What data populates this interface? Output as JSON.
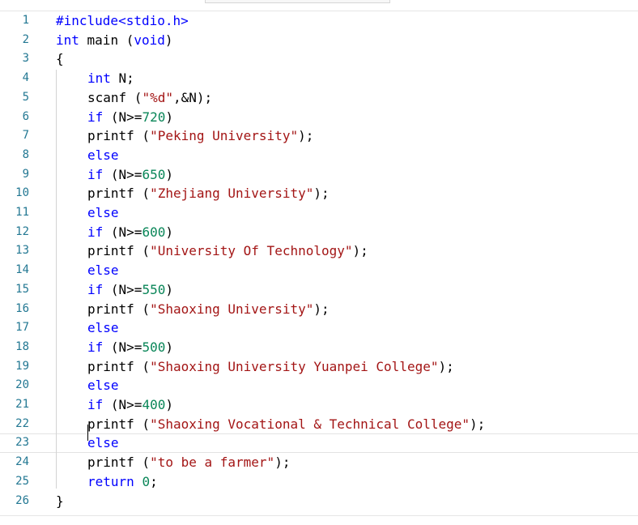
{
  "editor": {
    "lines": [
      {
        "num": "1",
        "indent": 0,
        "tokens": [
          {
            "t": "#include<stdio.h>",
            "c": "kw"
          }
        ]
      },
      {
        "num": "2",
        "indent": 0,
        "tokens": [
          {
            "t": "int",
            "c": "kw"
          },
          {
            "t": " main (",
            "c": "plain"
          },
          {
            "t": "void",
            "c": "kw"
          },
          {
            "t": ")",
            "c": "plain"
          }
        ]
      },
      {
        "num": "3",
        "indent": 0,
        "tokens": [
          {
            "t": "{",
            "c": "plain"
          }
        ]
      },
      {
        "num": "4",
        "indent": 1,
        "tokens": [
          {
            "t": "int",
            "c": "kw"
          },
          {
            "t": " N;",
            "c": "plain"
          }
        ]
      },
      {
        "num": "5",
        "indent": 1,
        "tokens": [
          {
            "t": "scanf (",
            "c": "plain"
          },
          {
            "t": "\"%d\"",
            "c": "str"
          },
          {
            "t": ",&N);",
            "c": "plain"
          }
        ]
      },
      {
        "num": "6",
        "indent": 1,
        "tokens": [
          {
            "t": "if",
            "c": "kw"
          },
          {
            "t": " (N>=",
            "c": "plain"
          },
          {
            "t": "720",
            "c": "num"
          },
          {
            "t": ")",
            "c": "plain"
          }
        ]
      },
      {
        "num": "7",
        "indent": 1,
        "tokens": [
          {
            "t": "printf (",
            "c": "plain"
          },
          {
            "t": "\"Peking University\"",
            "c": "str"
          },
          {
            "t": ");",
            "c": "plain"
          }
        ]
      },
      {
        "num": "8",
        "indent": 1,
        "tokens": [
          {
            "t": "else",
            "c": "kw"
          }
        ]
      },
      {
        "num": "9",
        "indent": 1,
        "tokens": [
          {
            "t": "if",
            "c": "kw"
          },
          {
            "t": " (N>=",
            "c": "plain"
          },
          {
            "t": "650",
            "c": "num"
          },
          {
            "t": ")",
            "c": "plain"
          }
        ]
      },
      {
        "num": "10",
        "indent": 1,
        "tokens": [
          {
            "t": "printf (",
            "c": "plain"
          },
          {
            "t": "\"Zhejiang University\"",
            "c": "str"
          },
          {
            "t": ");",
            "c": "plain"
          }
        ]
      },
      {
        "num": "11",
        "indent": 1,
        "tokens": [
          {
            "t": "else",
            "c": "kw"
          }
        ]
      },
      {
        "num": "12",
        "indent": 1,
        "tokens": [
          {
            "t": "if",
            "c": "kw"
          },
          {
            "t": " (N>=",
            "c": "plain"
          },
          {
            "t": "600",
            "c": "num"
          },
          {
            "t": ")",
            "c": "plain"
          }
        ]
      },
      {
        "num": "13",
        "indent": 1,
        "tokens": [
          {
            "t": "printf (",
            "c": "plain"
          },
          {
            "t": "\"University Of Technology\"",
            "c": "str"
          },
          {
            "t": ");",
            "c": "plain"
          }
        ]
      },
      {
        "num": "14",
        "indent": 1,
        "tokens": [
          {
            "t": "else",
            "c": "kw"
          }
        ]
      },
      {
        "num": "15",
        "indent": 1,
        "tokens": [
          {
            "t": "if",
            "c": "kw"
          },
          {
            "t": " (N>=",
            "c": "plain"
          },
          {
            "t": "550",
            "c": "num"
          },
          {
            "t": ")",
            "c": "plain"
          }
        ]
      },
      {
        "num": "16",
        "indent": 1,
        "tokens": [
          {
            "t": "printf (",
            "c": "plain"
          },
          {
            "t": "\"Shaoxing University\"",
            "c": "str"
          },
          {
            "t": ");",
            "c": "plain"
          }
        ]
      },
      {
        "num": "17",
        "indent": 1,
        "tokens": [
          {
            "t": "else",
            "c": "kw"
          }
        ]
      },
      {
        "num": "18",
        "indent": 1,
        "tokens": [
          {
            "t": "if",
            "c": "kw"
          },
          {
            "t": " (N>=",
            "c": "plain"
          },
          {
            "t": "500",
            "c": "num"
          },
          {
            "t": ")",
            "c": "plain"
          }
        ]
      },
      {
        "num": "19",
        "indent": 1,
        "tokens": [
          {
            "t": "printf (",
            "c": "plain"
          },
          {
            "t": "\"Shaoxing University Yuanpei College\"",
            "c": "str"
          },
          {
            "t": ");",
            "c": "plain"
          }
        ]
      },
      {
        "num": "20",
        "indent": 1,
        "tokens": [
          {
            "t": "else",
            "c": "kw"
          }
        ]
      },
      {
        "num": "21",
        "indent": 1,
        "tokens": [
          {
            "t": "if",
            "c": "kw"
          },
          {
            "t": " (N>=",
            "c": "plain"
          },
          {
            "t": "400",
            "c": "num"
          },
          {
            "t": ")",
            "c": "plain"
          }
        ]
      },
      {
        "num": "22",
        "indent": 1,
        "tokens": [
          {
            "t": "printf (",
            "c": "plain"
          },
          {
            "t": "\"Shaoxing Vocational & Technical College\"",
            "c": "str"
          },
          {
            "t": ");",
            "c": "plain"
          }
        ]
      },
      {
        "num": "23",
        "indent": 1,
        "current": true,
        "tokens": [
          {
            "t": "else",
            "c": "kw"
          }
        ]
      },
      {
        "num": "24",
        "indent": 1,
        "tokens": [
          {
            "t": "printf (",
            "c": "plain"
          },
          {
            "t": "\"to be a farmer\"",
            "c": "str"
          },
          {
            "t": ");",
            "c": "plain"
          }
        ]
      },
      {
        "num": "25",
        "indent": 1,
        "tokens": [
          {
            "t": "return",
            "c": "kw"
          },
          {
            "t": " ",
            "c": "plain"
          },
          {
            "t": "0",
            "c": "num"
          },
          {
            "t": ";",
            "c": "plain"
          }
        ]
      },
      {
        "num": "26",
        "indent": 0,
        "tokens": [
          {
            "t": "}",
            "c": "plain"
          }
        ]
      }
    ]
  }
}
